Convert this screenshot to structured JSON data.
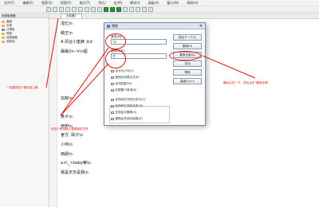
{
  "menu": [
    "文件(F)",
    "编辑(E)",
    "搜索(S)",
    "视图(V)",
    "格式(T)",
    "列(L)",
    "宏(M)",
    "脚本(I)",
    "高级(A)",
    "窗口(W)",
    "帮助(H)"
  ],
  "explorer": {
    "title": "资源管理器",
    "items": [
      {
        "icon": "folder-icon",
        "label": "桌面"
      },
      {
        "icon": "folder-icon",
        "label": "文档"
      },
      {
        "icon": "drive-icon",
        "label": "计算机"
      },
      {
        "icon": "folder-icon",
        "label": "网络"
      },
      {
        "icon": "folder-icon",
        "label": "控制面板"
      },
      {
        "icon": "folder-icon",
        "label": "回收站"
      }
    ]
  },
  "editor": {
    "tab_label": "无标题1",
    "lines": [
      "浅忆\\n",
      "萌王\\n",
      "A 风台小蜜蜂 大d",
      "躁躁/\\n--\\r\\n超",
      "",
      "",
      "",
      "",
      "加菲\\n",
      "",
      "黄子\\n",
      "伊伊\\n",
      "官方, 殿子\\n",
      "小伟\\n",
      "雨晨\\n",
      "a+\\_>baby嘛\\n",
      "我是天天是我\\n"
    ]
  },
  "dialog": {
    "title": "替换",
    "close": "✕",
    "find_label": "查找(N):",
    "find_value": "\\n",
    "replace_label": "替换为(P):",
    "replace_value": "P",
    "buttons": [
      "查找下一个(F)",
      "替换(R)",
      "替换全部(A)",
      "关闭",
      "帮助",
      "高级(V)>>"
    ],
    "options": [
      "区分大小写(C)",
      "使用正则表达式(E)",
      "全词匹配(W)",
      "匹配整个单词(B)"
    ],
    "lower_options": [
      "在所有打开的文件中(O)",
      "在所有打开的文件(M)",
      "在选区中替换(S)",
      "替换后关闭对话框(D)"
    ]
  },
  "annotations": {
    "left_note": "一定要把这个框勾选上哦",
    "center_note": "在这个框里输入要替换的字符",
    "right_note": "最后点击一下，然后点击\"替换全部\""
  }
}
